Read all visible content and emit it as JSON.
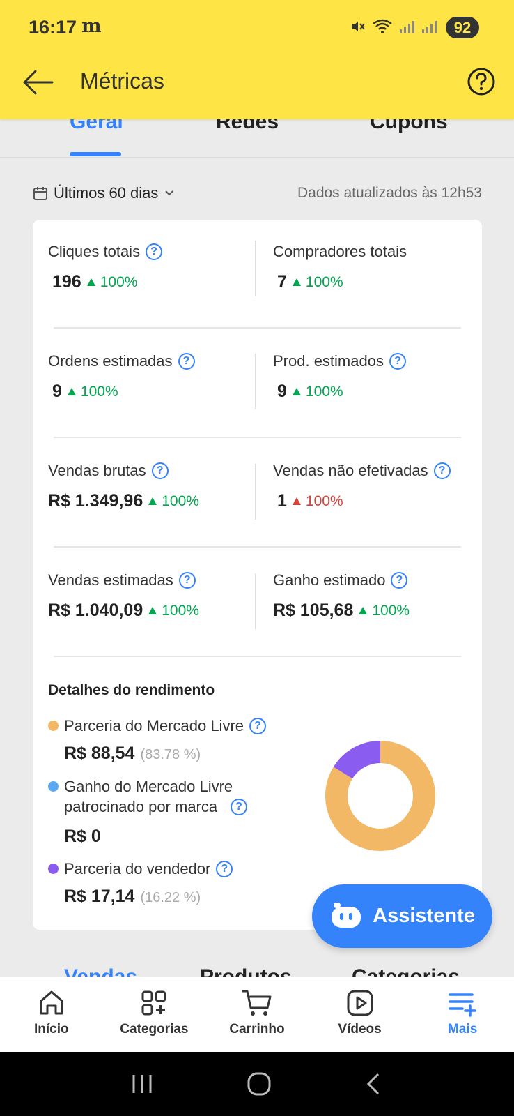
{
  "status_bar": {
    "time": "16:17",
    "app_logo": "m",
    "battery": "92"
  },
  "header": {
    "title": "Métricas"
  },
  "tabs": [
    {
      "label": "Geral",
      "active": true
    },
    {
      "label": "Redes",
      "active": false
    },
    {
      "label": "Cupons",
      "active": false
    }
  ],
  "filter": {
    "period": "Últimos 60 dias",
    "updated": "Dados atualizados às 12h53"
  },
  "metrics": [
    {
      "label": "Cliques totais",
      "value": "196",
      "trend": "100%",
      "help": true
    },
    {
      "label": "Compradores totais",
      "value": "7",
      "trend": "100%",
      "help": false
    },
    {
      "label": "Ordens estimadas",
      "value": "9",
      "trend": "100%",
      "help": true
    },
    {
      "label": "Prod. estimados",
      "value": "9",
      "trend": "100%",
      "help": true
    },
    {
      "label": "Vendas brutas",
      "value": "R$ 1.349,96",
      "trend": "100%",
      "help": true
    },
    {
      "label": "Vendas não efetivadas",
      "value": "1",
      "trend": "100%",
      "help": true
    },
    {
      "label": "Vendas estimadas",
      "value": "R$ 1.040,09",
      "trend": "100%",
      "help": true
    },
    {
      "label": "Ganho estimado",
      "value": "R$ 105,68",
      "trend": "100%",
      "help": true
    }
  ],
  "details": {
    "title": "Detalhes do rendimento",
    "items": [
      {
        "label": "Parceria do Mercado Livre",
        "amount": "R$ 88,54",
        "pct": "(83.78 %)",
        "color": "#f2b866",
        "share": 83.78
      },
      {
        "label": "Ganho do Mercado Livre patrocinado por marca",
        "amount": "R$ 0",
        "pct": "",
        "color": "#5aa9f2",
        "share": 0
      },
      {
        "label": "Parceria do vendedor",
        "amount": "R$ 17,14",
        "pct": "(16.22 %)",
        "color": "#8b5cf0",
        "share": 16.22
      }
    ]
  },
  "assistant": {
    "label": "Assistente"
  },
  "peek_tabs": [
    "Vendas",
    "Produtos",
    "Categorias"
  ],
  "bottom_nav": [
    {
      "label": "Início",
      "icon": "home-icon",
      "active": false
    },
    {
      "label": "Categorias",
      "icon": "categories-icon",
      "active": false
    },
    {
      "label": "Carrinho",
      "icon": "cart-icon",
      "active": false
    },
    {
      "label": "Vídeos",
      "icon": "video-icon",
      "active": false
    },
    {
      "label": "Mais",
      "icon": "menu-plus-icon",
      "active": true
    }
  ],
  "colors": {
    "header": "#fee444",
    "accent": "#3483fa",
    "positive": "#00a650",
    "negative": "#d9433a"
  }
}
